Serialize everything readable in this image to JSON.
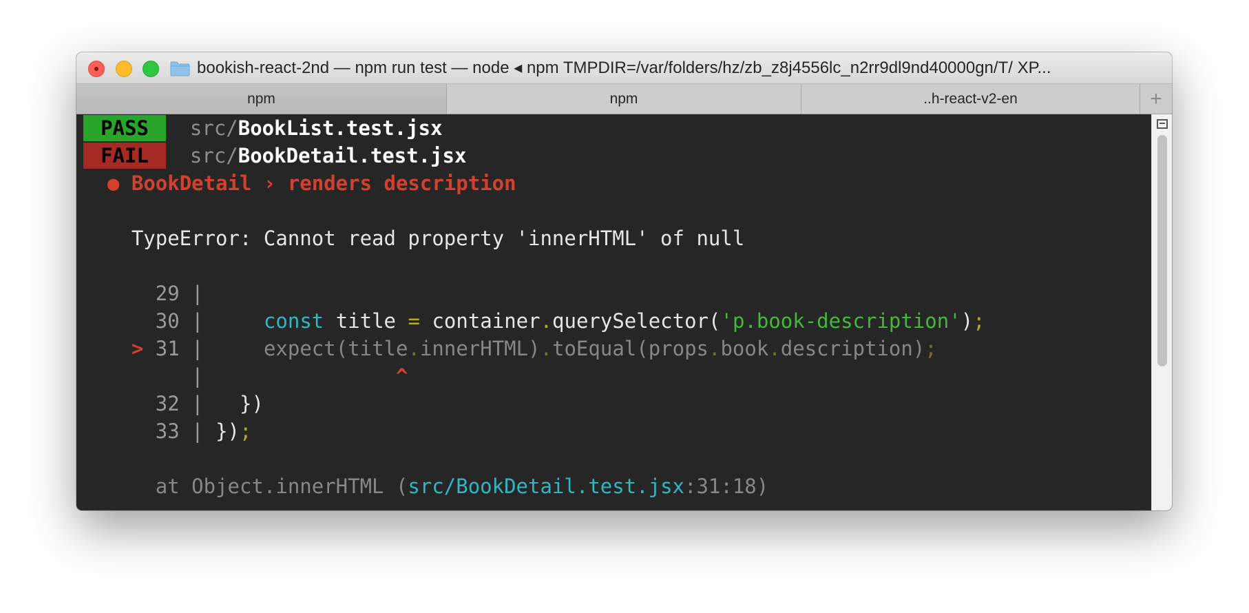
{
  "window": {
    "title": "bookish-react-2nd — npm run test — node ◂ npm TMPDIR=/var/folders/hz/zb_z8j4556lc_n2rr9dl9nd40000gn/T/ XP..."
  },
  "tabs": [
    {
      "label": "npm"
    },
    {
      "label": "npm"
    },
    {
      "label": "..h-react-v2-en"
    }
  ],
  "tab_add_label": "+",
  "terminal": {
    "pass_badge": "PASS",
    "pass_dir": "src/",
    "pass_file": "BookList.test.jsx",
    "fail_badge": "FAIL",
    "fail_dir": "src/",
    "fail_file": "BookDetail.test.jsx",
    "bullet": "●",
    "test_name": "BookDetail › renders description",
    "error_message": "TypeError: Cannot read property 'innerHTML' of null",
    "code": {
      "l29_num": "29",
      "l30_num": "30",
      "l31_num": "31",
      "l32_num": "32",
      "l33_num": "33",
      "pipe": "|",
      "marker": ">",
      "caret": "^",
      "l30_kw": "const",
      "l30_var": "title",
      "l30_eq": "=",
      "l30_obj": "container",
      "l30_dot": ".",
      "l30_fn": "querySelector(",
      "l30_str": "'p.book-description'",
      "l30_close": ")",
      "l30_semi": ";",
      "l31_expect": "expect(title",
      "l31_dot1": ".",
      "l31_inner": "innerHTML)",
      "l31_dot2": ".",
      "l31_toequal": "toEqual(props",
      "l31_dot3": ".",
      "l31_book": "book",
      "l31_dot4": ".",
      "l31_desc": "description)",
      "l31_semi": ";",
      "l32_code": "})",
      "l33_code": "})",
      "l33_semi": ";"
    },
    "stack": {
      "at": "at Object.innerHTML (",
      "file": "src/BookDetail.test.jsx",
      "loc": ":31:18)"
    }
  },
  "colors": {
    "pass": "#29a52b",
    "fail": "#a52a24",
    "error_red": "#d2402f",
    "keyword_cyan": "#30b7c2",
    "string_green": "#43b83a",
    "punct_yellow": "#b5ac1d",
    "terminal_bg": "#262626"
  }
}
